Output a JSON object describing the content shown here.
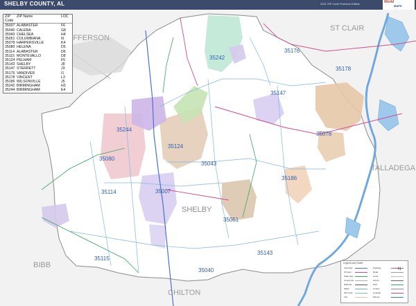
{
  "header": {
    "title": "SHELBY COUNTY, AL",
    "edition": "2021 ZIP Code Premium Edition"
  },
  "logo": {
    "line1": "World",
    "line2": "MAPS",
    "sub": "Market Maps Inc."
  },
  "zip_table": {
    "headers": [
      "ZIP Code",
      "ZIP Name",
      "LOC"
    ],
    "rows": [
      [
        "35007",
        "ALABASTER",
        "F6"
      ],
      [
        "35040",
        "CALERA",
        "G8"
      ],
      [
        "35043",
        "CHELSEA",
        "H4"
      ],
      [
        "35051",
        "COLUMBIANA",
        "I6"
      ],
      [
        "35078",
        "HARPERSVILLE",
        "K4"
      ],
      [
        "35080",
        "HELENA",
        "D5"
      ],
      [
        "35114",
        "ALABASTER",
        "D6"
      ],
      [
        "35115",
        "MONTEVALLO",
        "D8"
      ],
      [
        "35124",
        "PELHAM",
        "F5"
      ],
      [
        "35143",
        "SHELBY",
        "J8"
      ],
      [
        "35147",
        "STERRETT",
        "J3"
      ],
      [
        "35176",
        "VANDIVER",
        "I1"
      ],
      [
        "35178",
        "VINCENT",
        "L3"
      ],
      [
        "35186",
        "WILSONVILLE",
        "J5"
      ],
      [
        "35242",
        "BIRMINGHAM",
        "H3"
      ],
      [
        "35244",
        "BIRMINGHAM",
        "E4"
      ]
    ]
  },
  "county_labels": {
    "jefferson": "EFFERSON",
    "st_clair": "ST CLAIR",
    "talladega": "TALLADEGA",
    "shelby": "SHELBY",
    "bibb": "BIBB",
    "chilton": "CHILTON"
  },
  "zip_labels": {
    "z35242": "35242",
    "z35176": "35176",
    "z35178": "35178",
    "z35147": "35147",
    "z35078": "35078",
    "z35244": "35244",
    "z35124": "35124",
    "z35080": "35080",
    "z35043": "35043",
    "z35186": "35186",
    "z35114": "35114",
    "z35007": "35007",
    "z35051": "35051",
    "z35143": "35143",
    "z35115": "35115",
    "z35040": "35040"
  },
  "legend": {
    "title": "Legend and Scale",
    "rows_left": [
      "Interstate",
      "US Hwy",
      "State Hwy",
      "County Rd",
      "Railroad",
      "Water",
      "ZIP Code",
      "City"
    ],
    "rows_right": [
      "Highway",
      "Road",
      "Local",
      "Airport",
      "Park",
      "County",
      "Hospital",
      "School"
    ],
    "compass": "N"
  },
  "colors": {
    "title_bar": "#3c4a6b",
    "zip_label": "#2d5fb3",
    "county_label": "#9a9a9a",
    "water": "#9ec9ea",
    "river": "#6fa9dc"
  }
}
